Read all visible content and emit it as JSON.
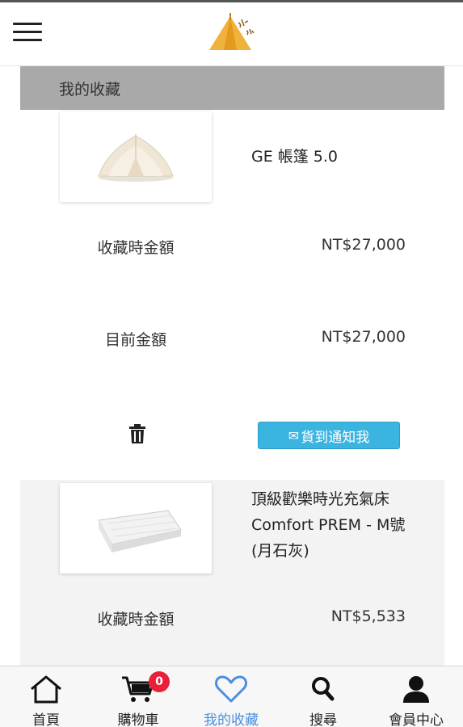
{
  "header": {
    "menu_icon": "hamburger-icon",
    "logo_icon": "tent-logo-icon"
  },
  "section": {
    "title": "我的收藏"
  },
  "favorites": [
    {
      "name": "GE 帳篷 5.0",
      "thumbnail": "bell-tent-image",
      "saved_price_label": "收藏時金額",
      "saved_price": "NT$27,000",
      "current_price_label": "目前金額",
      "current_price": "NT$27,000",
      "delete_icon": "trash-icon",
      "notify_label": "貨到通知我",
      "notify_icon": "envelope-icon"
    },
    {
      "name": "頂級歡樂時光充氣床Comfort PREM - M號(月石灰)",
      "thumbnail": "air-mattress-image",
      "saved_price_label": "收藏時金額",
      "saved_price": "NT$5,533"
    }
  ],
  "bottom_nav": {
    "items": [
      {
        "label": "首頁",
        "icon": "home-icon"
      },
      {
        "label": "購物車",
        "icon": "cart-icon",
        "badge": "0"
      },
      {
        "label": "我的收藏",
        "icon": "heart-icon",
        "active": true
      },
      {
        "label": "搜尋",
        "icon": "search-icon"
      },
      {
        "label": "會員中心",
        "icon": "user-icon"
      }
    ]
  },
  "colors": {
    "header_band": "#a9a9a9",
    "button_blue": "#3bb4e0",
    "active_nav": "#4a8fe0",
    "badge_red": "#e8203a"
  }
}
